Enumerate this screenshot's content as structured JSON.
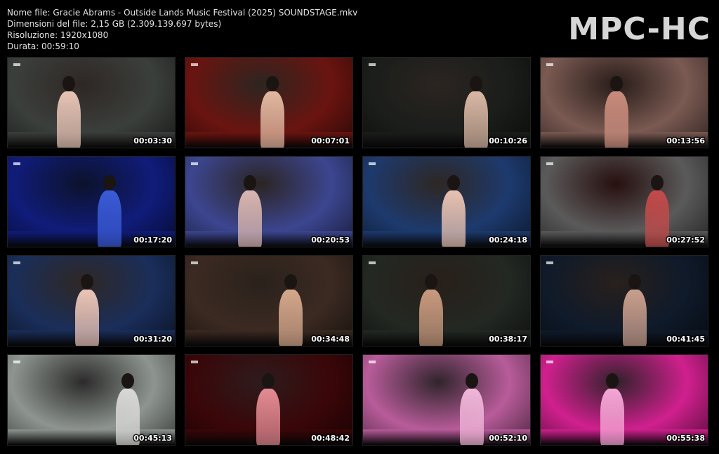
{
  "info": {
    "file_name": "Nome file: Gracie Abrams - Outside Lands Music Festival (2025) SOUNDSTAGE.mkv",
    "file_size": "Dimensioni del file: 2,15 GB (2.309.139.697 bytes)",
    "resolution": "Risoluzione: 1920x1080",
    "duration": "Durata: 00:59:10"
  },
  "logo": "MPC-HC",
  "thumbnails": [
    {
      "timestamp": "00:03:30",
      "bg": "#3b3f3c",
      "accent": "#e7c3b5"
    },
    {
      "timestamp": "00:07:01",
      "bg": "#6a1410",
      "accent": "#e2b8a0"
    },
    {
      "timestamp": "00:10:26",
      "bg": "#1a1d1a",
      "accent": "#d9b7a4"
    },
    {
      "timestamp": "00:13:56",
      "bg": "#7a5a52",
      "accent": "#c98c7c"
    },
    {
      "timestamp": "00:17:20",
      "bg": "#101c7a",
      "accent": "#3a5bd8"
    },
    {
      "timestamp": "00:20:53",
      "bg": "#3c4690",
      "accent": "#d9b6b0"
    },
    {
      "timestamp": "00:24:18",
      "bg": "#1d3a6e",
      "accent": "#e7c2b2"
    },
    {
      "timestamp": "00:27:52",
      "bg": "#5b5a5a",
      "accent": "#c24a4a"
    },
    {
      "timestamp": "00:31:20",
      "bg": "#1a2e5a",
      "accent": "#eac4b6"
    },
    {
      "timestamp": "00:34:48",
      "bg": "#3b2a22",
      "accent": "#d5a88c"
    },
    {
      "timestamp": "00:38:17",
      "bg": "#232823",
      "accent": "#c99a7e"
    },
    {
      "timestamp": "00:41:45",
      "bg": "#0f1a2a",
      "accent": "#c99f8e"
    },
    {
      "timestamp": "00:45:13",
      "bg": "#8e9590",
      "accent": "#d8d8d6"
    },
    {
      "timestamp": "00:48:42",
      "bg": "#3a0608",
      "accent": "#e48a92"
    },
    {
      "timestamp": "00:52:10",
      "bg": "#b85c9a",
      "accent": "#f0b6d8"
    },
    {
      "timestamp": "00:55:38",
      "bg": "#d0208e",
      "accent": "#f6a6d6"
    }
  ]
}
